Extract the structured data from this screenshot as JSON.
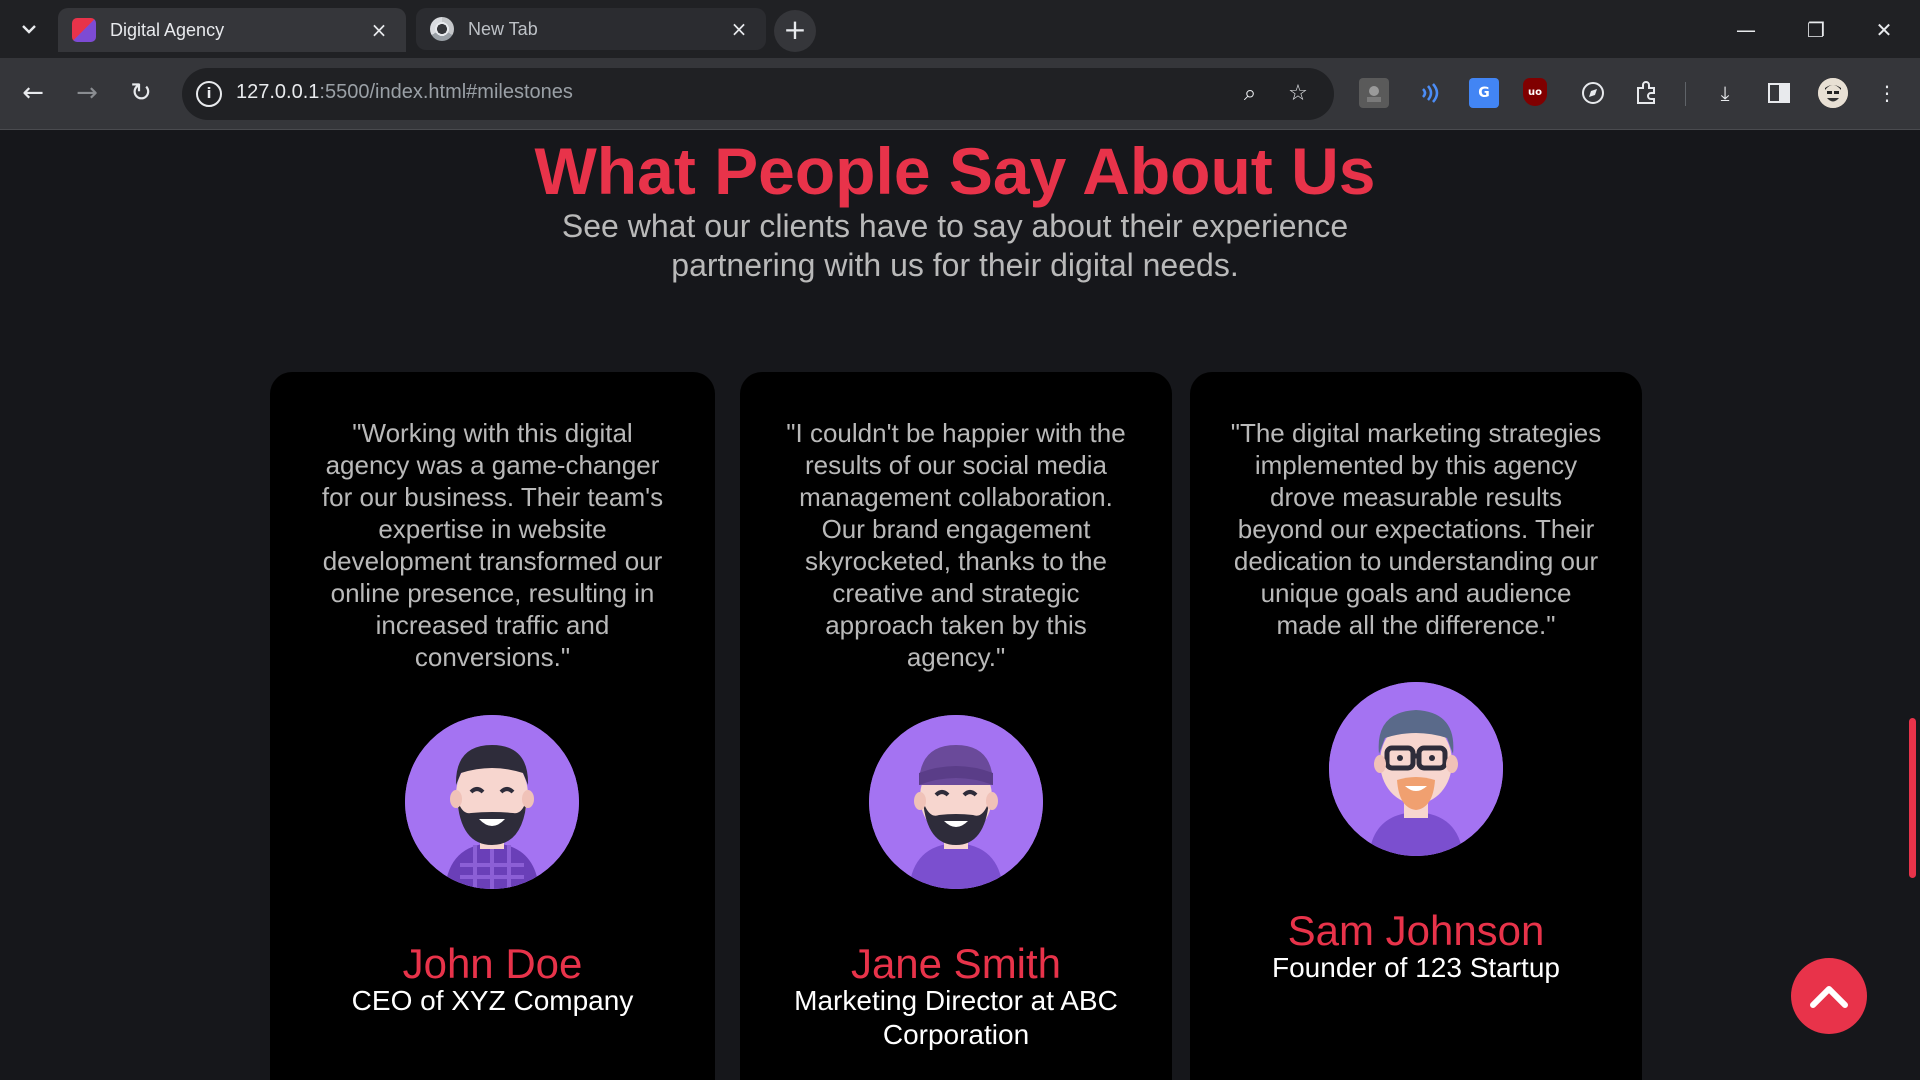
{
  "browser": {
    "tabs": [
      {
        "title": "Digital Agency",
        "active": true
      },
      {
        "title": "New Tab",
        "active": false
      }
    ],
    "url_host": "127.0.0.1",
    "url_rest": ":5500/index.html#milestones",
    "icons": {
      "tab_search": "chevron-down",
      "close": "×",
      "new_tab": "+",
      "minimize": "—",
      "restore": "❐",
      "window_close": "✕",
      "back": "←",
      "forward": "→",
      "reload": "↻",
      "info": "i",
      "zoom": "⌕",
      "bookmark": "☆",
      "download": "⤓",
      "menu": "⋮"
    }
  },
  "section": {
    "title": "What People Say About Us",
    "subtitle": "See what our clients have to say about their experience partnering with us for their digital needs."
  },
  "testimonials": [
    {
      "quote": "\"Working with this digital agency was a game-changer for our business. Their team's expertise in website development transformed our online presence, resulting in increased traffic and conversions.\"",
      "name": "John Doe",
      "role": "CEO of XYZ Company"
    },
    {
      "quote": "\"I couldn't be happier with the results of our social media management collaboration. Our brand engagement skyrocketed, thanks to the creative and strategic approach taken by this agency.\"",
      "name": "Jane Smith",
      "role": "Marketing Director at ABC Corporation"
    },
    {
      "quote": "\"The digital marketing strategies implemented by this agency drove measurable results beyond our expectations. Their dedication to understanding our unique goals and audience made all the difference.\"",
      "name": "Sam Johnson",
      "role": "Founder of 123 Startup"
    }
  ],
  "colors": {
    "accent": "#e8334a",
    "avatar_bg": "#a473f2",
    "card_bg": "#000000",
    "page_bg": "#16171b"
  }
}
